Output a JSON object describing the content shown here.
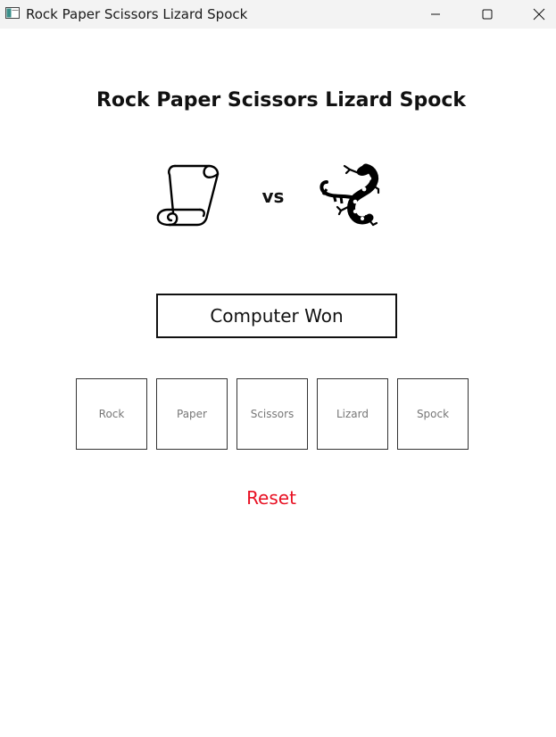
{
  "window": {
    "title": "Rock Paper Scissors Lizard Spock",
    "icon": "app-window-icon",
    "controls": {
      "minimize_icon": "minimize-icon",
      "maximize_icon": "maximize-icon",
      "close_icon": "close-icon"
    }
  },
  "game": {
    "title": "Rock Paper Scissors Lizard Spock",
    "player_choice_icon": "paper-scroll-icon",
    "vs_label": "vs",
    "computer_choice_icon": "lizard-icon",
    "result": "Computer Won"
  },
  "choices": [
    {
      "label": "Rock"
    },
    {
      "label": "Paper"
    },
    {
      "label": "Scissors"
    },
    {
      "label": "Lizard"
    },
    {
      "label": "Spock"
    }
  ],
  "reset_label": "Reset",
  "colors": {
    "titlebar": "#f3f3f3",
    "reset": "#e81123",
    "choice_text": "#777777",
    "border": "#111111"
  }
}
